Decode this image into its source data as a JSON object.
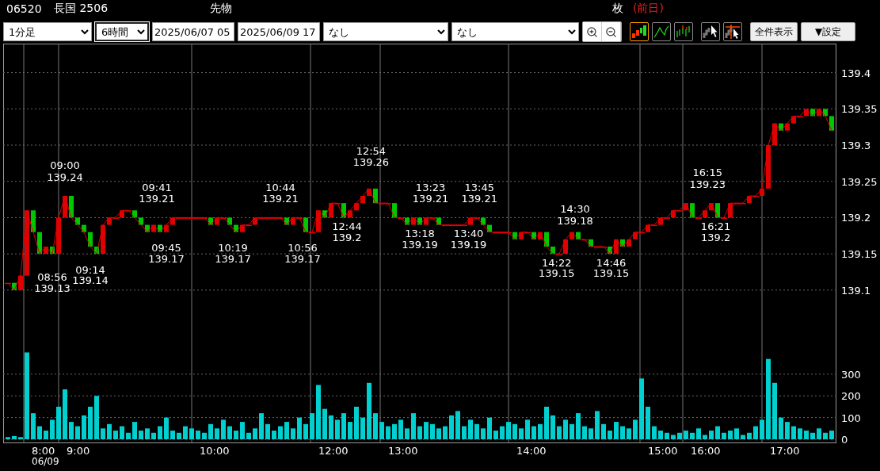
{
  "header": {
    "code": "06520",
    "name": "長国 2506",
    "category": "先物",
    "unit": "枚",
    "note": "(前日)"
  },
  "toolbar": {
    "interval": {
      "value": "1分足"
    },
    "span": {
      "value": "6時間",
      "focused": true
    },
    "start": {
      "value": "2025/06/07 05"
    },
    "end": {
      "value": "2025/06/09 17"
    },
    "indicator_1": {
      "value": "なし"
    },
    "indicator_2": {
      "value": "なし"
    },
    "chart_types": [
      {
        "kind": "candle",
        "selected": true
      },
      {
        "kind": "line",
        "selected": false
      },
      {
        "kind": "bar",
        "selected": false
      }
    ],
    "buttons": [
      "全件表示",
      "▼設定"
    ]
  },
  "price_chart": {
    "chart_data": {
      "type": "line",
      "grid": true,
      "ylim": [
        139.02,
        139.44
      ],
      "yticks": [
        {
          "value": 139.1,
          "label": "139.1"
        },
        {
          "value": 139.15,
          "label": "139.15"
        },
        {
          "value": 139.2,
          "label": "139.2"
        },
        {
          "value": 139.25,
          "label": "139.25"
        },
        {
          "value": 139.3,
          "label": "139.3"
        },
        {
          "value": 139.35,
          "label": "139.35"
        },
        {
          "value": 139.4,
          "label": "139.4"
        }
      ],
      "series": [
        {
          "color": "#e00000",
          "values": [
            139.11,
            139.1,
            139.12,
            139.21,
            139.18,
            139.15,
            139.16,
            139.15,
            139.2,
            139.23,
            139.2,
            139.19,
            139.18,
            139.16,
            139.15,
            139.19,
            139.2,
            139.2,
            139.21,
            139.21,
            139.2,
            139.19,
            139.18,
            139.19,
            139.18,
            139.19,
            139.2,
            139.2,
            139.2,
            139.2,
            139.2,
            139.2,
            139.19,
            139.2,
            139.2,
            139.19,
            139.18,
            139.19,
            139.19,
            139.2,
            139.2,
            139.2,
            139.2,
            139.2,
            139.19,
            139.2,
            139.2,
            139.18,
            139.18,
            139.21,
            139.2,
            139.22,
            139.22,
            139.2,
            139.21,
            139.22,
            139.23,
            139.24,
            139.22,
            139.22,
            139.22,
            139.2,
            139.2,
            139.19,
            139.2,
            139.19,
            139.2,
            139.2,
            139.19,
            139.19,
            139.19,
            139.19,
            139.19,
            139.2,
            139.2,
            139.19,
            139.18,
            139.18,
            139.18,
            139.18,
            139.17,
            139.18,
            139.18,
            139.17,
            139.18,
            139.16,
            139.15,
            139.15,
            139.17,
            139.18,
            139.17,
            139.17,
            139.16,
            139.16,
            139.16,
            139.15,
            139.17,
            139.16,
            139.17,
            139.18,
            139.18,
            139.19,
            139.19,
            139.2,
            139.2,
            139.21,
            139.21,
            139.22,
            139.2,
            139.2,
            139.21,
            139.22,
            139.2,
            139.2,
            139.22,
            139.22,
            139.22,
            139.23,
            139.23,
            139.24,
            139.3,
            139.33,
            139.32,
            139.33,
            139.34,
            139.34,
            139.35,
            139.34,
            139.35,
            139.34,
            139.32
          ]
        }
      ],
      "annotations": [
        "09:00",
        "139.24",
        "08:56",
        "139.13",
        "09:14",
        "139.14",
        "09:41",
        "139.21",
        "09:45",
        "139.17",
        "10:19",
        "139.17",
        "10:44",
        "139.21",
        "10:56",
        "139.17",
        "12:44",
        "139.2",
        "12:54",
        "139.26",
        "13:18",
        "139.19",
        "13:23",
        "139.21",
        "13:40",
        "139.19",
        "13:45",
        "139.21",
        "14:22",
        "139.15",
        "14:30",
        "139.18",
        "14:46",
        "139.15",
        "16:15",
        "139.23",
        "16:21",
        "139.2"
      ]
    }
  },
  "volume_chart": {
    "time_axis": {
      "labels": [
        "8:00",
        "9:00",
        "10:00",
        "12:00",
        "13:00",
        "14:00",
        "15:00",
        "16:00",
        "17:00"
      ],
      "date": "06/09"
    },
    "chart_data": {
      "type": "bar",
      "grid": true,
      "ylim": [
        0,
        420
      ],
      "yticks": [
        {
          "value": 0,
          "label": "0"
        },
        {
          "value": 100,
          "label": "100"
        },
        {
          "value": 200,
          "label": "200"
        },
        {
          "value": 300,
          "label": "300"
        }
      ],
      "series": [
        {
          "color": "#00d0d0",
          "values": [
            10,
            15,
            10,
            400,
            120,
            60,
            40,
            90,
            150,
            230,
            80,
            60,
            110,
            150,
            200,
            50,
            70,
            40,
            60,
            30,
            80,
            40,
            50,
            30,
            60,
            100,
            40,
            30,
            60,
            50,
            40,
            30,
            70,
            50,
            90,
            60,
            40,
            80,
            30,
            50,
            120,
            70,
            40,
            60,
            80,
            50,
            100,
            70,
            120,
            250,
            140,
            110,
            90,
            120,
            80,
            150,
            100,
            260,
            120,
            80,
            60,
            70,
            90,
            50,
            120,
            60,
            80,
            70,
            50,
            60,
            110,
            130,
            60,
            90,
            70,
            50,
            100,
            40,
            60,
            80,
            70,
            50,
            90,
            60,
            70,
            150,
            110,
            60,
            90,
            70,
            120,
            60,
            50,
            130,
            70,
            40,
            80,
            60,
            50,
            90,
            280,
            150,
            60,
            40,
            30,
            20,
            30,
            40,
            30,
            50,
            20,
            40,
            60,
            30,
            40,
            50,
            20,
            30,
            60,
            90,
            370,
            260,
            100,
            80,
            60,
            50,
            40,
            30,
            50,
            30,
            40
          ]
        }
      ]
    }
  }
}
